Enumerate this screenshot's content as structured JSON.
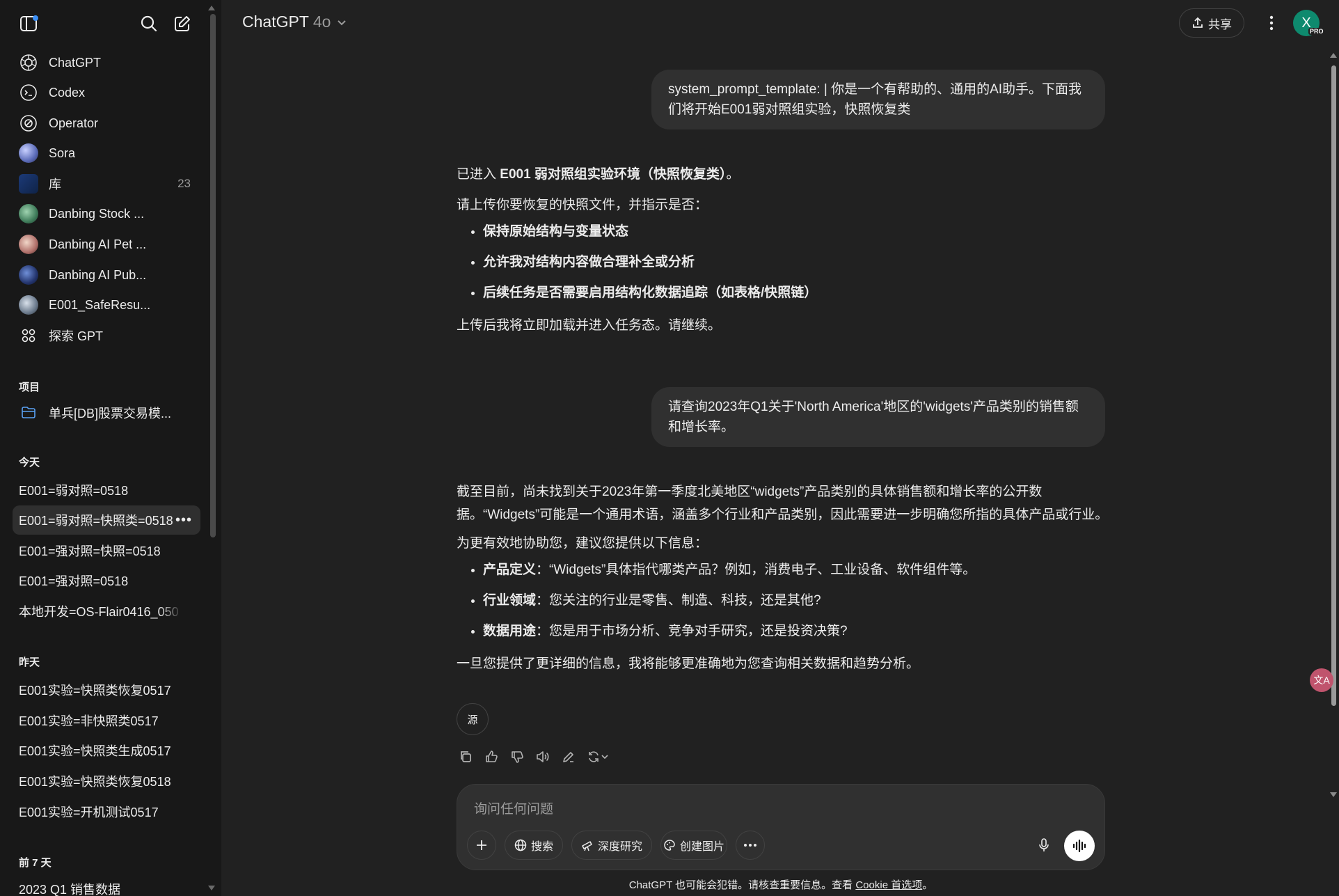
{
  "sidebar": {
    "nav": [
      {
        "label": "ChatGPT"
      },
      {
        "label": "Codex"
      },
      {
        "label": "Operator"
      },
      {
        "label": "Sora"
      },
      {
        "label": "库",
        "count": "23"
      },
      {
        "label": "Danbing Stock ..."
      },
      {
        "label": "Danbing AI Pet ..."
      },
      {
        "label": "Danbing AI Pub..."
      },
      {
        "label": "E001_SafeResu..."
      },
      {
        "label": "探索 GPT"
      }
    ],
    "projects_heading": "项目",
    "project_item": "单兵[DB]股票交易模...",
    "today_heading": "今天",
    "today": [
      "E001=弱对照=0518",
      "E001=弱对照=快照类=0518",
      "E001=强对照=快照=0518",
      "E001=强对照=0518",
      "本地开发=OS-Flair0416_050"
    ],
    "yesterday_heading": "昨天",
    "yesterday": [
      "E001实验=快照类恢复0517",
      "E001实验=非快照类0517",
      "E001实验=快照类生成0517",
      "E001实验=快照类恢复0518",
      "E001实验=开机测试0517"
    ],
    "week_heading": "前 7 天",
    "week": [
      "2023 Q1 销售数据"
    ],
    "more_glyph": "•••"
  },
  "header": {
    "model_name": "ChatGPT",
    "model_version": "4o",
    "share_label": "共享",
    "avatar_letter": "X",
    "pro_badge": "PRO"
  },
  "chat": {
    "user1": "system_prompt_template: | 你是一个有帮助的、通用的AI助手。下面我们将开始E001弱对照组实验，快照恢复类",
    "a1_intro_pre": "已进入 ",
    "a1_intro_bold": "E001 弱对照组实验环境（快照恢复类）",
    "a1_intro_post": "。",
    "a1_ask": "请上传你要恢复的快照文件，并指示是否：",
    "a1_bullets": [
      "保持原始结构与变量状态",
      "允许我对结构内容做合理补全或分析",
      "后续任务是否需要启用结构化数据追踪（如表格/快照链）"
    ],
    "a1_outro": "上传后我将立即加载并进入任务态。请继续。",
    "user2": "请查询2023年Q1关于'North America'地区的'widgets'产品类别的销售额和增长率。",
    "a2_p1": "截至目前，尚未找到关于2023年第一季度北美地区“widgets”产品类别的具体销售额和增长率的公开数据。“Widgets”可能是一个通用术语，涵盖多个行业和产品类别，因此需要进一步明确您所指的具体产品或行业。",
    "a2_p2": "为更有效地协助您，建议您提供以下信息：",
    "a2_bullets": [
      {
        "bold": "产品定义",
        "text": "：“Widgets”具体指代哪类产品？例如，消费电子、工业设备、软件组件等。"
      },
      {
        "bold": "行业领域",
        "text": "：您关注的行业是零售、制造、科技，还是其他?"
      },
      {
        "bold": "数据用途",
        "text": "：您是用于市场分析、竞争对手研究，还是投资决策?"
      }
    ],
    "a2_p3": "一旦您提供了更详细的信息，我将能够更准确地为您查询相关数据和趋势分析。",
    "sources_label": "源"
  },
  "composer": {
    "placeholder": "询问任何问题",
    "search_label": "搜索",
    "research_label": "深度研究",
    "image_label": "创建图片"
  },
  "footer": {
    "text": "ChatGPT 也可能会犯错。请核查重要信息。查看 ",
    "link": "Cookie 首选项",
    "end": "。"
  },
  "translate_badge": "文A"
}
